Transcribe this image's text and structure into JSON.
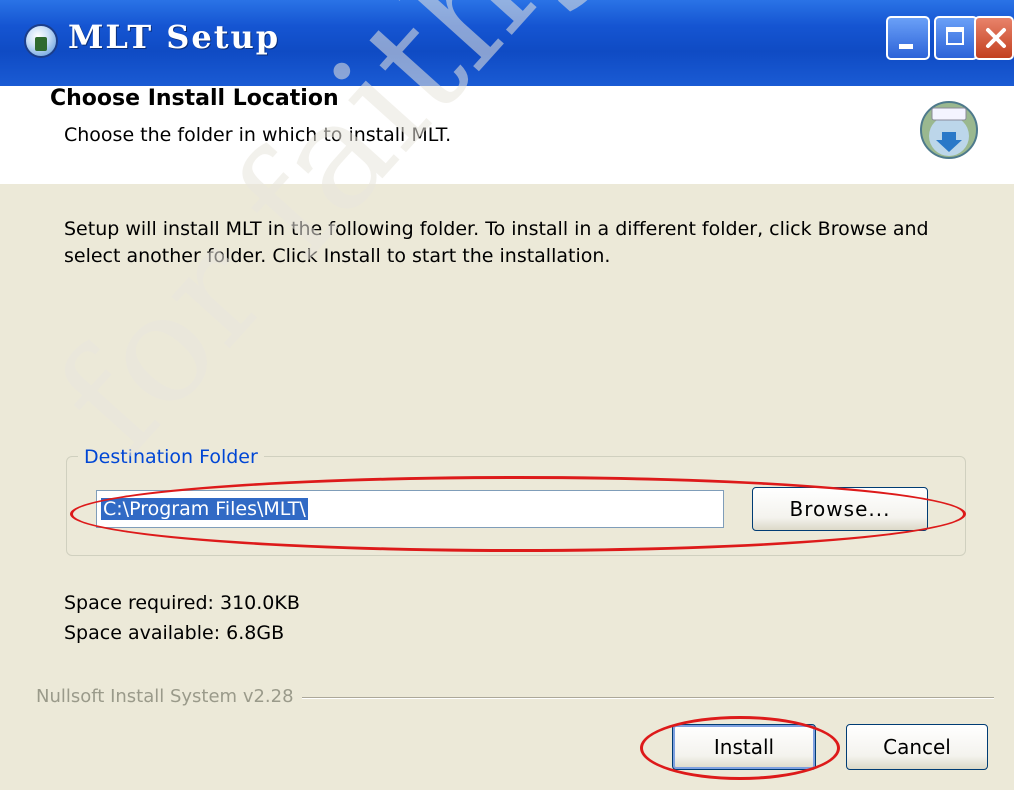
{
  "window": {
    "title": "MLT Setup"
  },
  "header": {
    "title": "Choose Install Location",
    "subtitle": "Choose the folder in which to install MLT."
  },
  "body": {
    "description": "Setup will install MLT in the following folder. To install in a different folder, click Browse and select another folder. Click Install to start the installation.",
    "destination_folder_label": "Destination Folder",
    "destination_path": "C:\\Program Files\\MLT\\",
    "browse_label": "Browse...",
    "space_required": "Space required: 310.0KB",
    "space_available": "Space available: 6.8GB"
  },
  "footer": {
    "branding": "Nullsoft Install System v2.28",
    "install_label": "Install",
    "cancel_label": "Cancel"
  },
  "watermark": "for faithgofar"
}
